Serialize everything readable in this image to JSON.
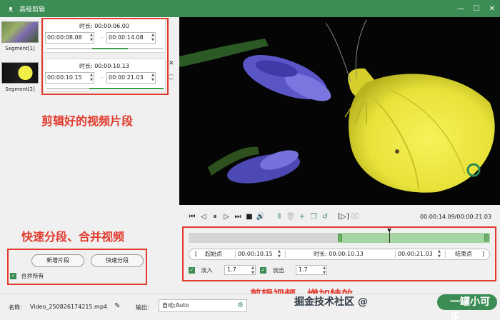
{
  "window": {
    "title": "高级剪辑",
    "app_icon": "rabbit-icon"
  },
  "segments": [
    {
      "label": "Segment[1]",
      "duration_label": "时长: 00:00:06.00",
      "start": "00:00:08.08",
      "end": "00:00:14.08"
    },
    {
      "label": "Segment[2]",
      "duration_label": "时长: 00:00:10.13",
      "start": "00:00:10.15",
      "end": "00:00:21.03"
    }
  ],
  "annotations": {
    "clips": "剪辑好的视频片段",
    "split_merge": "快速分段、合并视频",
    "effects": "剪辑视频，增加特效"
  },
  "buttons": {
    "add_segment": "新增片段",
    "quick_split": "快速分段"
  },
  "merge_all": {
    "label": "合并所有",
    "checked": true
  },
  "player": {
    "time": "00:00:14.09/00:00:21.03"
  },
  "timeline": {
    "selection_start": 0.495,
    "selection_end": 1.0,
    "playhead": 0.665
  },
  "range": {
    "start_button": "起始点",
    "start_value": "00:00:10.15",
    "duration_label": "时长: 00:00:10.13",
    "end_value": "00:00:21.03",
    "end_button": "结束点"
  },
  "effects": {
    "fade_in_label": "淡入",
    "fade_in_value": "1.7",
    "fade_out_label": "淡出",
    "fade_out_value": "1.7"
  },
  "footer": {
    "name_label": "名称:",
    "name_value": "Video_250826174215.mp4",
    "output_label": "输出:",
    "output_value": "自动;Auto"
  },
  "watermark": {
    "left": "掘金技术社区 @",
    "right": "一罐小可乐"
  },
  "colors": {
    "accent": "#3c8c55",
    "annotation": "#e23b2e"
  }
}
